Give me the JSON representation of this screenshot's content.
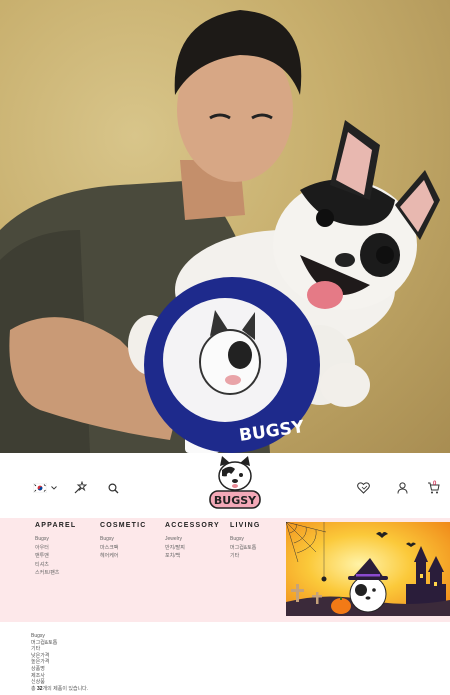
{
  "hero": {
    "fan_text": "BUGSY"
  },
  "header": {
    "icons": [
      "korea-flag-icon",
      "chevron-down-icon",
      "magic-wand-icon",
      "search-icon",
      "heart-icon",
      "user-icon",
      "cart-icon"
    ],
    "cart_count": "0",
    "logo_text": "BUGSY"
  },
  "menu": {
    "apparel": {
      "title": "APPAREL",
      "items": [
        "Bugsy",
        "아우터",
        "맨투맨",
        "티셔츠",
        "스커트/팬츠"
      ]
    },
    "cosmetic": {
      "title": "COSMETIC",
      "items": [
        "Bugsy",
        "마스크팩",
        "헤어케어"
      ]
    },
    "accessory": {
      "title": "ACCESSORY",
      "items": [
        "Jewelry",
        "반지/팔찌",
        "포치/백"
      ]
    },
    "living": {
      "title": "LIVING",
      "items": [
        "Bugsy",
        "머그컵&토톱",
        "기타"
      ]
    }
  },
  "list": {
    "items": [
      "Bugsy",
      "머그컵&토톱",
      "기타",
      "낮은가격",
      "높은가격",
      "상품명",
      "제조사",
      "신상품"
    ],
    "total_prefix": "총",
    "total_count": "32",
    "total_suffix": "개의 제품이 있습니다."
  },
  "colors": {
    "menu_bg": "#fde8ea",
    "accent": "#d23c5f",
    "fan_blue": "#1e2a8c"
  }
}
